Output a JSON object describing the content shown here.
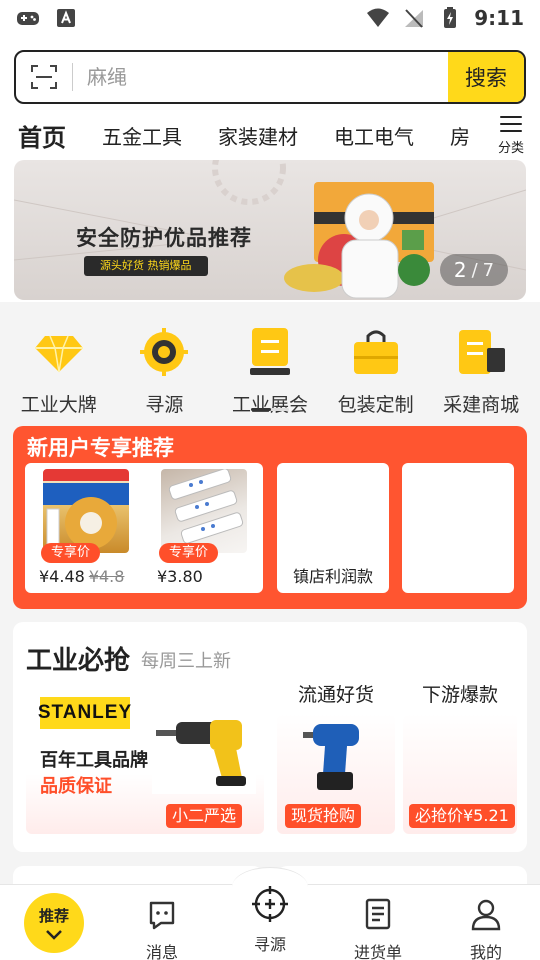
{
  "status_bar": {
    "time": "9:11"
  },
  "search": {
    "placeholder": "麻绳",
    "button_label": "搜索"
  },
  "tabs": [
    {
      "label": "首页"
    },
    {
      "label": "五金工具"
    },
    {
      "label": "家装建材"
    },
    {
      "label": "电工电气"
    },
    {
      "label": "房"
    }
  ],
  "category_button_label": "分类",
  "banner": {
    "title": "安全防护优品推荐",
    "tagline": "源头好货 热销爆品",
    "pager_current": "2",
    "pager_sep": "/",
    "pager_total": "7"
  },
  "quick_links": [
    {
      "label": "工业大牌",
      "icon": "diamond-icon"
    },
    {
      "label": "寻源",
      "icon": "target-icon"
    },
    {
      "label": "工业展会",
      "icon": "exhibition-icon"
    },
    {
      "label": "包装定制",
      "icon": "bag-icon"
    },
    {
      "label": "采建商城",
      "icon": "store-icon"
    }
  ],
  "new_user": {
    "title": "新用户专享推荐",
    "products": [
      {
        "badge": "专享价",
        "price": "¥4.48",
        "old_price": "¥4.8"
      },
      {
        "badge": "专享价",
        "price": "¥3.80",
        "old_price": ""
      }
    ],
    "card2_label": "镇店利润款"
  },
  "must_grab": {
    "title": "工业必抢",
    "subtitle": "每周三上新",
    "brand_logo_text": "STANLEY",
    "left_line1": "百年工具品牌",
    "left_line2": "品质保证",
    "left_tag": "小二严选",
    "mid_caption": "流通好货",
    "mid_tag": "现货抢购",
    "right_caption": "下游爆款",
    "right_tag": "必抢价¥5.21"
  },
  "bottom_nav": {
    "home_label": "推荐",
    "items": [
      {
        "label": "消息"
      },
      {
        "label": "寻源"
      },
      {
        "label": "进货单"
      },
      {
        "label": "我的"
      }
    ]
  },
  "colors": {
    "accent": "#ffd91a",
    "promo": "#ff5530",
    "tag": "#ff4f2a"
  }
}
